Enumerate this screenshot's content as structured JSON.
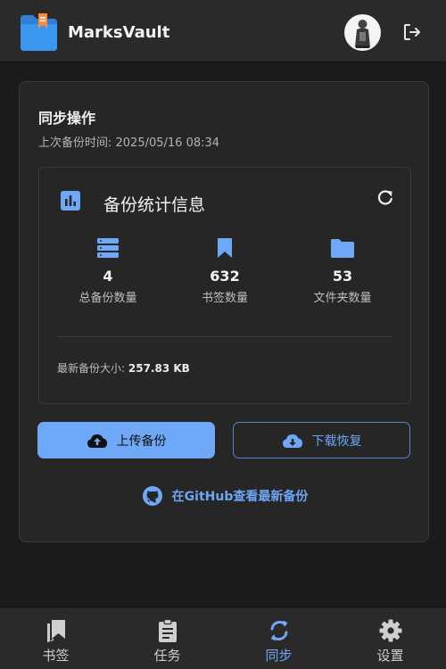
{
  "header": {
    "app_title": "MarksVault",
    "logo_icon": "bookmark-folder-icon",
    "avatar_icon": "user-avatar",
    "logout_icon": "logout-icon"
  },
  "sync": {
    "title": "同步操作",
    "last_backup": "上次备份时间: 2025/05/16 08:34",
    "stats": {
      "title": "备份统计信息",
      "items": [
        {
          "value": "4",
          "label": "总备份数量",
          "icon": "storage-icon"
        },
        {
          "value": "632",
          "label": "书签数量",
          "icon": "bookmark-icon"
        },
        {
          "value": "53",
          "label": "文件夹数量",
          "icon": "folder-icon"
        }
      ],
      "latest_size_label": "最新备份大小:",
      "latest_size_value": "257.83 KB"
    },
    "upload_label": "上传备份",
    "download_label": "下载恢复",
    "github_label": "在GitHub查看最新备份"
  },
  "nav": {
    "items": [
      {
        "label": "书签",
        "icon": "bookmarks-icon"
      },
      {
        "label": "任务",
        "icon": "clipboard-icon"
      },
      {
        "label": "同步",
        "icon": "sync-icon"
      },
      {
        "label": "设置",
        "icon": "gear-icon"
      }
    ],
    "active_index": 2
  },
  "colors": {
    "accent": "#6fa8f7",
    "background": "#1b1b1b",
    "surface": "#262626"
  }
}
